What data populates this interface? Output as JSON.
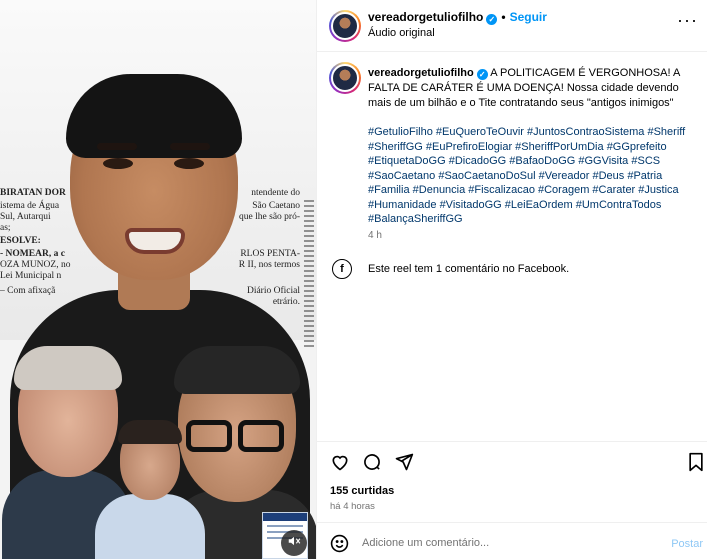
{
  "media": {
    "document_lines": [
      "BIRATAN DOR",
      "istema de Água",
      "Sul, Autarqui",
      "as;",
      "ESOLVE:",
      "- NOMEAR, a c",
      "OZA MUNOZ, no",
      "Lei Municipal n",
      "– Com afixaçã"
    ],
    "document_right": [
      "ntendente do",
      "São Caetano",
      "que lhe são pró-",
      "RLOS PENTA-",
      "R II, nos termos",
      "Diário Oficial",
      "etrário."
    ]
  },
  "post": {
    "username": "vereadorgetuliofilho",
    "follow_label": "Seguir",
    "audio_label": "Áudio original",
    "caption_text": "A POLITICAGEM É VERGONHOSA! A FALTA DE CARÁTER É UMA DOENÇA! Nossa cidade devendo mais de um bilhão e o Tite contratando seus \"antigos inimigos\"",
    "hashtags": [
      "#GetulioFilho",
      "#EuQueroTeOuvir",
      "#JuntosContraoSistema",
      "#Sheriff",
      "#SheriffGG",
      "#EuPrefiroElogiar",
      "#SheriffPorUmDia",
      "#GGprefeito",
      "#EtiquetaDoGG",
      "#DicadoGG",
      "#BafaoDoGG",
      "#GGVisita",
      "#SCS",
      "#SaoCaetano",
      "#SaoCaetanoDoSul",
      "#Vereador",
      "#Deus",
      "#Patria",
      "#Familia",
      "#Denuncia",
      "#Fiscalizacao",
      "#Coragem",
      "#Carater",
      "#Justica",
      "#Humanidade",
      "#VisitadoGG",
      "#LeiEaOrdem",
      "#UmContraTodos",
      "#BalançaSheriffGG"
    ],
    "caption_time": "4 h",
    "facebook_note": "Este reel tem 1 comentário no Facebook.",
    "likes": "155 curtidas",
    "posted_ago": "há 4 horas",
    "comment_placeholder": "Adicione um comentário...",
    "post_label": "Postar"
  },
  "icons": {
    "verified": "verified-badge-icon",
    "more": "more-options-icon",
    "like": "heart-icon",
    "comment": "comment-bubble-icon",
    "share": "paper-plane-icon",
    "save": "bookmark-icon",
    "emoji": "smiley-icon",
    "facebook": "facebook-icon",
    "mute": "speaker-muted-icon"
  },
  "colors": {
    "accent_blue": "#0095f6",
    "hashtag_blue": "#00376b",
    "muted_gray": "#737373",
    "post_disabled": "#8fc8f5"
  }
}
